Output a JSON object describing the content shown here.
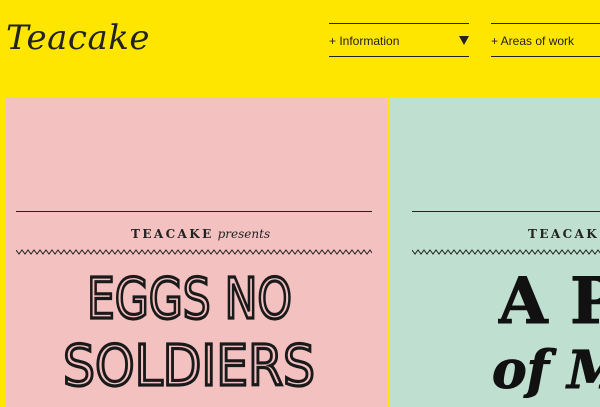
{
  "brand": {
    "logo_text": "Teacake"
  },
  "nav": {
    "information": {
      "label": "+ Information",
      "icon": "caret-down-icon"
    },
    "areas_of_work": {
      "label": "+ Areas of work"
    }
  },
  "cards": [
    {
      "presenter": "TEACAKE",
      "presents_word": "presents",
      "title_line_1": "EGGS NO",
      "title_line_2": "SOLDIERS",
      "background": "#f4c1c1"
    },
    {
      "presenter": "TEACAK",
      "title_line_1": "A P",
      "title_line_2": "of M",
      "background": "#bfe0d0"
    }
  ],
  "colors": {
    "page_background": "#ffe600",
    "ink": "#1c1c1c"
  }
}
